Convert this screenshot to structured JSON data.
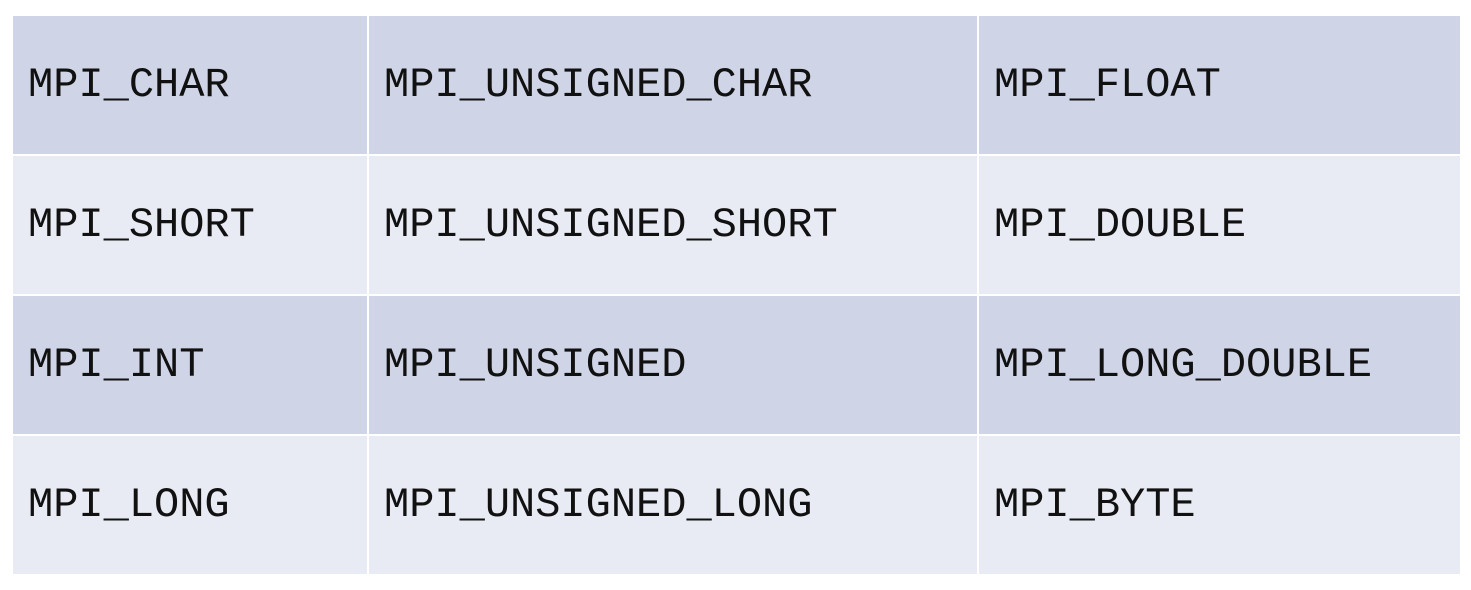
{
  "table": {
    "rows": [
      [
        "MPI_CHAR",
        "MPI_UNSIGNED_CHAR",
        "MPI_FLOAT"
      ],
      [
        "MPI_SHORT",
        "MPI_UNSIGNED_SHORT",
        "MPI_DOUBLE"
      ],
      [
        "MPI_INT",
        "MPI_UNSIGNED",
        "MPI_LONG_DOUBLE"
      ],
      [
        "MPI_LONG",
        "MPI_UNSIGNED_LONG",
        "MPI_BYTE"
      ]
    ]
  },
  "colors": {
    "row_dark": "#cfd5e6",
    "row_light": "#e8ebf4",
    "text": "#111111"
  }
}
